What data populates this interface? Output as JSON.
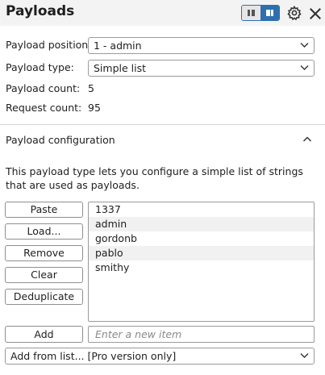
{
  "header": {
    "title": "Payloads"
  },
  "form": {
    "payload_position_label": "Payload position:",
    "payload_position_value": "1 - admin",
    "payload_type_label": "Payload type:",
    "payload_type_value": "Simple list",
    "payload_count_label": "Payload count:",
    "payload_count_value": "5",
    "request_count_label": "Request count:",
    "request_count_value": "95"
  },
  "config": {
    "title": "Payload configuration",
    "description": "This payload type lets you configure a simple list of strings that are used as payloads.",
    "buttons": {
      "paste": "Paste",
      "load": "Load...",
      "remove": "Remove",
      "clear": "Clear",
      "deduplicate": "Deduplicate",
      "add": "Add"
    },
    "items": [
      "1337",
      "admin",
      "gordonb",
      "pablo",
      "smithy"
    ],
    "new_item_placeholder": "Enter a new item",
    "add_from_list_value": "Add from list... [Pro version only]"
  },
  "icons": {
    "layout_toggle": "layout-toggle-icon",
    "settings": "gear-icon",
    "close": "close-icon",
    "collapse": "chevron-up-icon",
    "dropdown": "chevron-down-icon"
  },
  "colors": {
    "accent": "#2f6fad",
    "header_bg": "#f3f3f3",
    "alt_row": "#f1f1f1"
  }
}
